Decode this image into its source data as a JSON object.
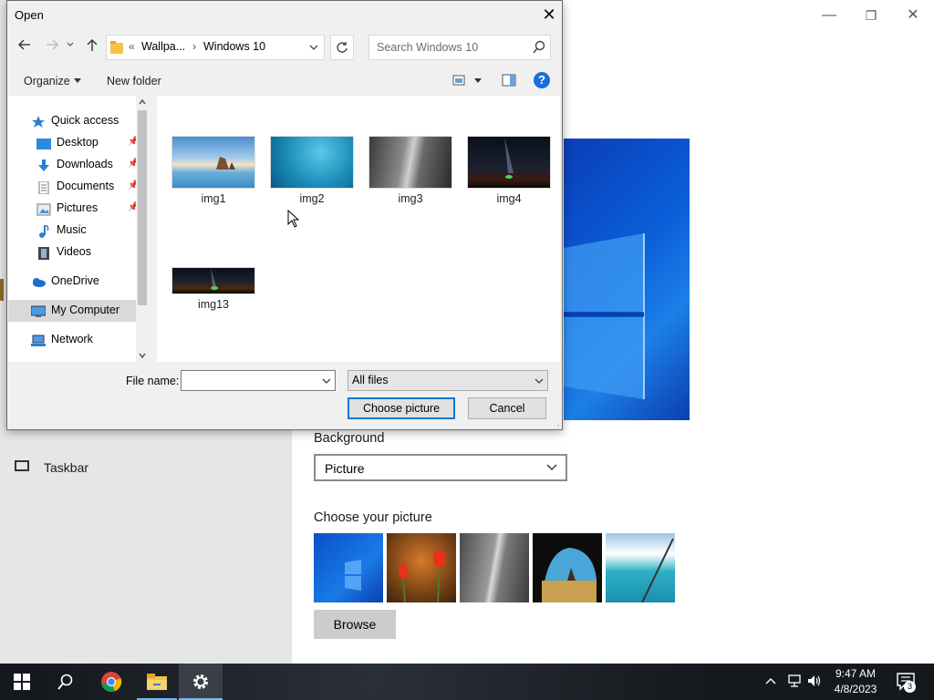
{
  "settings": {
    "taskbar_label": "Taskbar",
    "background_label": "Background",
    "background_value": "Picture",
    "choose_picture_label": "Choose your picture",
    "browse_label": "Browse",
    "window_controls": {
      "minimize": "—",
      "restore": "❐",
      "close": "✕"
    }
  },
  "dialog": {
    "title": "Open",
    "close": "✕",
    "nav": {
      "back": "←",
      "forward": "→",
      "up": "↑"
    },
    "address": {
      "prefix": "«",
      "crumb1": "Wallpa...",
      "sep": "›",
      "crumb2": "Windows 10"
    },
    "search_placeholder": "Search Windows 10",
    "toolbar": {
      "organize": "Organize",
      "new_folder": "New folder",
      "help": "?"
    },
    "nav_items": [
      {
        "label": "Quick access",
        "icon": "star-icon"
      },
      {
        "label": "Desktop",
        "icon": "desktop-icon",
        "pinned": true
      },
      {
        "label": "Downloads",
        "icon": "download-icon",
        "pinned": true
      },
      {
        "label": "Documents",
        "icon": "documents-icon",
        "pinned": true
      },
      {
        "label": "Pictures",
        "icon": "pictures-icon",
        "pinned": true
      },
      {
        "label": "Music",
        "icon": "music-icon"
      },
      {
        "label": "Videos",
        "icon": "videos-icon"
      },
      {
        "label": "OneDrive",
        "icon": "cloud-icon"
      },
      {
        "label": "My Computer",
        "icon": "computer-icon",
        "selected": true
      },
      {
        "label": "Network",
        "icon": "network-icon"
      }
    ],
    "files": [
      {
        "name": "img1"
      },
      {
        "name": "img2"
      },
      {
        "name": "img3"
      },
      {
        "name": "img4"
      },
      {
        "name": "img13"
      }
    ],
    "file_name_label": "File name:",
    "file_name_value": "",
    "file_type": "All files",
    "choose_button": "Choose picture",
    "cancel_button": "Cancel"
  },
  "taskbar": {
    "time": "9:47 AM",
    "date": "4/8/2023",
    "notification_count": "3",
    "tray_chevron": "^"
  },
  "colors": {
    "accent": "#0078d7",
    "dialog_bg": "#f0f0f0",
    "taskbar_bg": "#1a1f26"
  }
}
